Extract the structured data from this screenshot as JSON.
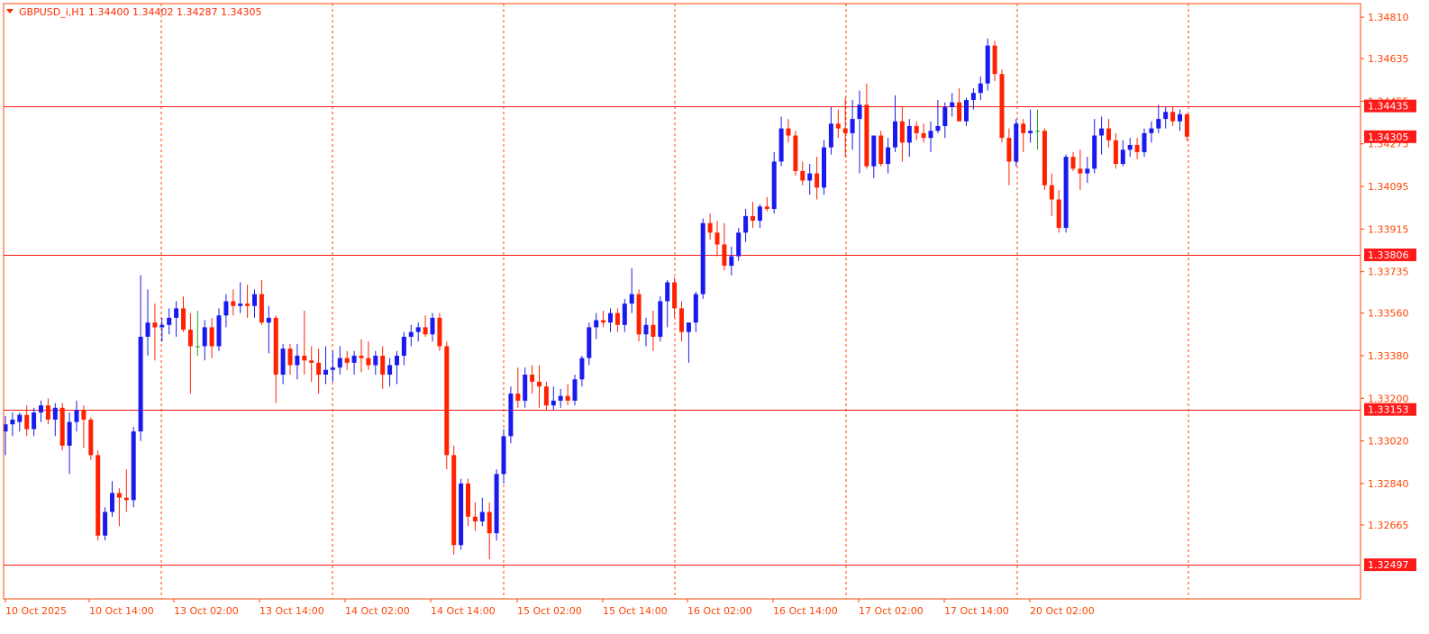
{
  "header": {
    "symbol_line": "GBPUSD_i,H1  1.34400 1.34402 1.34287 1.34305"
  },
  "colors": {
    "up": "#1a1aee",
    "down": "#ff2200",
    "doji": "#2aa02a",
    "axis": "#ff4400",
    "grid": "#ff4400",
    "level": "#ff1a1a",
    "label_bg": "#ff1a1a",
    "label_text": "#ffffff",
    "background": "#ffffff"
  },
  "chart_data": {
    "type": "candlestick",
    "title": "GBPUSD_i,H1",
    "ylim": [
      1.32425,
      1.34835
    ],
    "y_ticks": [
      "1.34810",
      "1.34635",
      "1.34455",
      "1.34275",
      "1.34095",
      "1.33915",
      "1.33735",
      "1.33560",
      "1.33380",
      "1.33200",
      "1.33020",
      "1.32840",
      "1.32665"
    ],
    "x_labels": [
      "10 Oct 2025",
      "10 Oct 14:00",
      "13 Oct 02:00",
      "13 Oct 14:00",
      "14 Oct 02:00",
      "14 Oct 14:00",
      "15 Oct 02:00",
      "15 Oct 14:00",
      "16 Oct 02:00",
      "16 Oct 14:00",
      "17 Oct 02:00",
      "17 Oct 14:00",
      "20 Oct 02:00"
    ],
    "levels": [
      {
        "value": 1.34435,
        "label": "1.34435"
      },
      {
        "value": 1.33806,
        "label": "1.33806"
      },
      {
        "value": 1.33153,
        "label": "1.33153"
      },
      {
        "value": 1.32497,
        "label": "1.32497"
      }
    ],
    "current_price": {
      "value": 1.34305,
      "label": "1.34305"
    },
    "candles": [
      [
        1.3306,
        1.33125,
        1.3296,
        1.3309
      ],
      [
        1.3309,
        1.3314,
        1.3304,
        1.3311
      ],
      [
        1.331,
        1.3314,
        1.3306,
        1.3313
      ],
      [
        1.3313,
        1.3317,
        1.3304,
        1.3307
      ],
      [
        1.3307,
        1.3316,
        1.3304,
        1.3314
      ],
      [
        1.3314,
        1.3319,
        1.331,
        1.3317
      ],
      [
        1.3317,
        1.332,
        1.3309,
        1.3311
      ],
      [
        1.3311,
        1.3318,
        1.3304,
        1.3316
      ],
      [
        1.3316,
        1.3318,
        1.3298,
        1.33
      ],
      [
        1.33,
        1.3314,
        1.3288,
        1.331
      ],
      [
        1.331,
        1.3319,
        1.3306,
        1.3315
      ],
      [
        1.3315,
        1.3317,
        1.3299,
        1.3311
      ],
      [
        1.3311,
        1.3312,
        1.3294,
        1.3296
      ],
      [
        1.3296,
        1.3298,
        1.326,
        1.3262
      ],
      [
        1.3262,
        1.3274,
        1.326,
        1.3272
      ],
      [
        1.3272,
        1.3285,
        1.327,
        1.328
      ],
      [
        1.328,
        1.3282,
        1.3266,
        1.3278
      ],
      [
        1.3278,
        1.329,
        1.3272,
        1.3277
      ],
      [
        1.3277,
        1.3308,
        1.3274,
        1.3306
      ],
      [
        1.3306,
        1.3372,
        1.3302,
        1.3346
      ],
      [
        1.3346,
        1.3366,
        1.3338,
        1.3352
      ],
      [
        1.3352,
        1.336,
        1.3336,
        1.335
      ],
      [
        1.335,
        1.3354,
        1.3344,
        1.3351
      ],
      [
        1.3351,
        1.3358,
        1.3347,
        1.3354
      ],
      [
        1.3354,
        1.3361,
        1.3346,
        1.3358
      ],
      [
        1.3358,
        1.3363,
        1.3348,
        1.3349
      ],
      [
        1.3349,
        1.3356,
        1.3322,
        1.3342
      ],
      [
        1.3342,
        1.3357,
        1.3338,
        1.3342
      ],
      [
        1.3342,
        1.3353,
        1.3336,
        1.335
      ],
      [
        1.335,
        1.3354,
        1.3337,
        1.3342
      ],
      [
        1.3342,
        1.3358,
        1.334,
        1.3355
      ],
      [
        1.3355,
        1.3364,
        1.335,
        1.3361
      ],
      [
        1.3361,
        1.3366,
        1.3355,
        1.3359
      ],
      [
        1.3359,
        1.3369,
        1.3356,
        1.336
      ],
      [
        1.336,
        1.3368,
        1.3354,
        1.3359
      ],
      [
        1.3359,
        1.3366,
        1.3354,
        1.3364
      ],
      [
        1.3364,
        1.337,
        1.3351,
        1.3352
      ],
      [
        1.3352,
        1.3359,
        1.3339,
        1.3354
      ],
      [
        1.3354,
        1.3355,
        1.3318,
        1.333
      ],
      [
        1.333,
        1.3343,
        1.3326,
        1.3341
      ],
      [
        1.3341,
        1.3343,
        1.333,
        1.3334
      ],
      [
        1.3334,
        1.3343,
        1.3328,
        1.3338
      ],
      [
        1.3338,
        1.3357,
        1.333,
        1.3336
      ],
      [
        1.3336,
        1.3342,
        1.3327,
        1.3335
      ],
      [
        1.3335,
        1.3341,
        1.3322,
        1.333
      ],
      [
        1.333,
        1.3342,
        1.3326,
        1.3332
      ],
      [
        1.3332,
        1.334,
        1.3327,
        1.3333
      ],
      [
        1.3333,
        1.3342,
        1.333,
        1.3337
      ],
      [
        1.3337,
        1.334,
        1.3332,
        1.3335
      ],
      [
        1.3335,
        1.334,
        1.333,
        1.3338
      ],
      [
        1.3338,
        1.3345,
        1.3331,
        1.3337
      ],
      [
        1.3337,
        1.3344,
        1.3332,
        1.3334
      ],
      [
        1.3334,
        1.334,
        1.333,
        1.3338
      ],
      [
        1.3338,
        1.3342,
        1.3324,
        1.333
      ],
      [
        1.333,
        1.3337,
        1.3325,
        1.3334
      ],
      [
        1.3334,
        1.334,
        1.3326,
        1.3338
      ],
      [
        1.3338,
        1.3348,
        1.3334,
        1.3346
      ],
      [
        1.3346,
        1.3351,
        1.3342,
        1.3348
      ],
      [
        1.3348,
        1.3352,
        1.3344,
        1.335
      ],
      [
        1.335,
        1.3355,
        1.3346,
        1.3347
      ],
      [
        1.3347,
        1.3356,
        1.3344,
        1.3354
      ],
      [
        1.3354,
        1.3356,
        1.334,
        1.3342
      ],
      [
        1.3342,
        1.3344,
        1.329,
        1.3296
      ],
      [
        1.3296,
        1.33,
        1.3254,
        1.3258
      ],
      [
        1.3258,
        1.3286,
        1.3256,
        1.3284
      ],
      [
        1.3284,
        1.3286,
        1.3266,
        1.327
      ],
      [
        1.327,
        1.3276,
        1.3264,
        1.3268
      ],
      [
        1.3268,
        1.3278,
        1.3266,
        1.3272
      ],
      [
        1.3272,
        1.3276,
        1.3252,
        1.3263
      ],
      [
        1.3263,
        1.329,
        1.326,
        1.3288
      ],
      [
        1.3288,
        1.3307,
        1.3284,
        1.3304
      ],
      [
        1.3304,
        1.3325,
        1.3301,
        1.3322
      ],
      [
        1.3322,
        1.3333,
        1.3316,
        1.3319
      ],
      [
        1.3319,
        1.3333,
        1.3316,
        1.333
      ],
      [
        1.333,
        1.3334,
        1.3322,
        1.3327
      ],
      [
        1.3327,
        1.3334,
        1.3316,
        1.3325
      ],
      [
        1.3325,
        1.3327,
        1.3315,
        1.3317
      ],
      [
        1.3317,
        1.3325,
        1.3315,
        1.3319
      ],
      [
        1.3319,
        1.3324,
        1.3316,
        1.3321
      ],
      [
        1.3321,
        1.3326,
        1.3317,
        1.3319
      ],
      [
        1.3319,
        1.333,
        1.3317,
        1.3328
      ],
      [
        1.3328,
        1.3338,
        1.3325,
        1.3337
      ],
      [
        1.3337,
        1.3352,
        1.3334,
        1.335
      ],
      [
        1.335,
        1.3356,
        1.3345,
        1.3353
      ],
      [
        1.3353,
        1.3357,
        1.335,
        1.3352
      ],
      [
        1.3352,
        1.3358,
        1.3348,
        1.3356
      ],
      [
        1.3356,
        1.3358,
        1.3348,
        1.3351
      ],
      [
        1.3351,
        1.3362,
        1.3348,
        1.336
      ],
      [
        1.336,
        1.3375,
        1.3356,
        1.3364
      ],
      [
        1.3364,
        1.3366,
        1.3344,
        1.3347
      ],
      [
        1.3347,
        1.3354,
        1.3342,
        1.3351
      ],
      [
        1.3351,
        1.3357,
        1.334,
        1.3346
      ],
      [
        1.3346,
        1.3363,
        1.3344,
        1.3361
      ],
      [
        1.3361,
        1.337,
        1.335,
        1.3369
      ],
      [
        1.3369,
        1.3371,
        1.3354,
        1.3358
      ],
      [
        1.3358,
        1.3361,
        1.3344,
        1.3348
      ],
      [
        1.3348,
        1.3352,
        1.3335,
        1.3352
      ],
      [
        1.3352,
        1.3365,
        1.3348,
        1.3364
      ],
      [
        1.3364,
        1.3396,
        1.3362,
        1.3394
      ],
      [
        1.3394,
        1.3398,
        1.3387,
        1.339
      ],
      [
        1.339,
        1.3395,
        1.338,
        1.3385
      ],
      [
        1.3385,
        1.3394,
        1.3374,
        1.3376
      ],
      [
        1.3376,
        1.3384,
        1.3372,
        1.338
      ],
      [
        1.338,
        1.3392,
        1.3378,
        1.339
      ],
      [
        1.339,
        1.34,
        1.3386,
        1.3397
      ],
      [
        1.3397,
        1.3403,
        1.3392,
        1.3395
      ],
      [
        1.3395,
        1.3402,
        1.3392,
        1.3401
      ],
      [
        1.3401,
        1.3405,
        1.3399,
        1.34
      ],
      [
        1.34,
        1.3424,
        1.3398,
        1.342
      ],
      [
        1.342,
        1.3439,
        1.3418,
        1.3434
      ],
      [
        1.3434,
        1.3438,
        1.3428,
        1.3431
      ],
      [
        1.3431,
        1.3433,
        1.3414,
        1.3416
      ],
      [
        1.3416,
        1.342,
        1.341,
        1.3412
      ],
      [
        1.3412,
        1.3419,
        1.3406,
        1.3415
      ],
      [
        1.3415,
        1.3422,
        1.3404,
        1.3409
      ],
      [
        1.3409,
        1.3429,
        1.3406,
        1.3426
      ],
      [
        1.3426,
        1.3443,
        1.3423,
        1.3436
      ],
      [
        1.3436,
        1.3442,
        1.343,
        1.3434
      ],
      [
        1.3434,
        1.3447,
        1.3422,
        1.3432
      ],
      [
        1.3432,
        1.3446,
        1.3425,
        1.3438
      ],
      [
        1.3438,
        1.345,
        1.3415,
        1.3444
      ],
      [
        1.3444,
        1.3453,
        1.3417,
        1.3418
      ],
      [
        1.3418,
        1.3431,
        1.3413,
        1.3431
      ],
      [
        1.3431,
        1.3433,
        1.3418,
        1.3419
      ],
      [
        1.3419,
        1.343,
        1.3415,
        1.3426
      ],
      [
        1.3426,
        1.3448,
        1.3424,
        1.3437
      ],
      [
        1.3437,
        1.3443,
        1.342,
        1.3428
      ],
      [
        1.3428,
        1.3438,
        1.3422,
        1.3435
      ],
      [
        1.3435,
        1.3437,
        1.3429,
        1.3432
      ],
      [
        1.3432,
        1.3436,
        1.3428,
        1.343
      ],
      [
        1.343,
        1.3437,
        1.3424,
        1.3433
      ],
      [
        1.3433,
        1.3446,
        1.3432,
        1.3435
      ],
      [
        1.3435,
        1.3445,
        1.343,
        1.3443
      ],
      [
        1.3443,
        1.3449,
        1.3439,
        1.3445
      ],
      [
        1.3445,
        1.3451,
        1.3441,
        1.3437
      ],
      [
        1.3437,
        1.3447,
        1.3435,
        1.3446
      ],
      [
        1.3446,
        1.3451,
        1.3442,
        1.3449
      ],
      [
        1.3449,
        1.3456,
        1.3446,
        1.3453
      ],
      [
        1.3453,
        1.3472,
        1.345,
        1.3469
      ],
      [
        1.3469,
        1.3471,
        1.3454,
        1.3457
      ],
      [
        1.3457,
        1.3459,
        1.3428,
        1.343
      ],
      [
        1.343,
        1.3434,
        1.341,
        1.342
      ],
      [
        1.342,
        1.3438,
        1.3418,
        1.3436
      ],
      [
        1.3436,
        1.3438,
        1.3424,
        1.3432
      ],
      [
        1.3432,
        1.3442,
        1.3428,
        1.3433
      ],
      [
        1.3433,
        1.3442,
        1.3425,
        1.3433
      ],
      [
        1.3433,
        1.3434,
        1.3408,
        1.341
      ],
      [
        1.341,
        1.3415,
        1.3397,
        1.3404
      ],
      [
        1.3404,
        1.3408,
        1.339,
        1.3392
      ],
      [
        1.3392,
        1.3423,
        1.339,
        1.3422
      ],
      [
        1.3422,
        1.3424,
        1.3416,
        1.3417
      ],
      [
        1.3417,
        1.3425,
        1.3408,
        1.3415
      ],
      [
        1.3415,
        1.3422,
        1.3411,
        1.3417
      ],
      [
        1.3417,
        1.3438,
        1.3415,
        1.3431
      ],
      [
        1.3431,
        1.3439,
        1.3423,
        1.3434
      ],
      [
        1.3434,
        1.3438,
        1.3426,
        1.3429
      ],
      [
        1.3429,
        1.3432,
        1.3417,
        1.3419
      ],
      [
        1.3419,
        1.3429,
        1.3418,
        1.3425
      ],
      [
        1.3425,
        1.343,
        1.3422,
        1.3427
      ],
      [
        1.3427,
        1.343,
        1.3421,
        1.3424
      ],
      [
        1.3424,
        1.3434,
        1.3422,
        1.3432
      ],
      [
        1.3432,
        1.3437,
        1.3428,
        1.3434
      ],
      [
        1.3434,
        1.3444,
        1.3432,
        1.3438
      ],
      [
        1.3438,
        1.3443,
        1.3434,
        1.3441
      ],
      [
        1.3441,
        1.3443,
        1.3435,
        1.3437
      ],
      [
        1.3437,
        1.3442,
        1.3433,
        1.344
      ],
      [
        1.344,
        1.34402,
        1.34287,
        1.34305
      ]
    ]
  }
}
